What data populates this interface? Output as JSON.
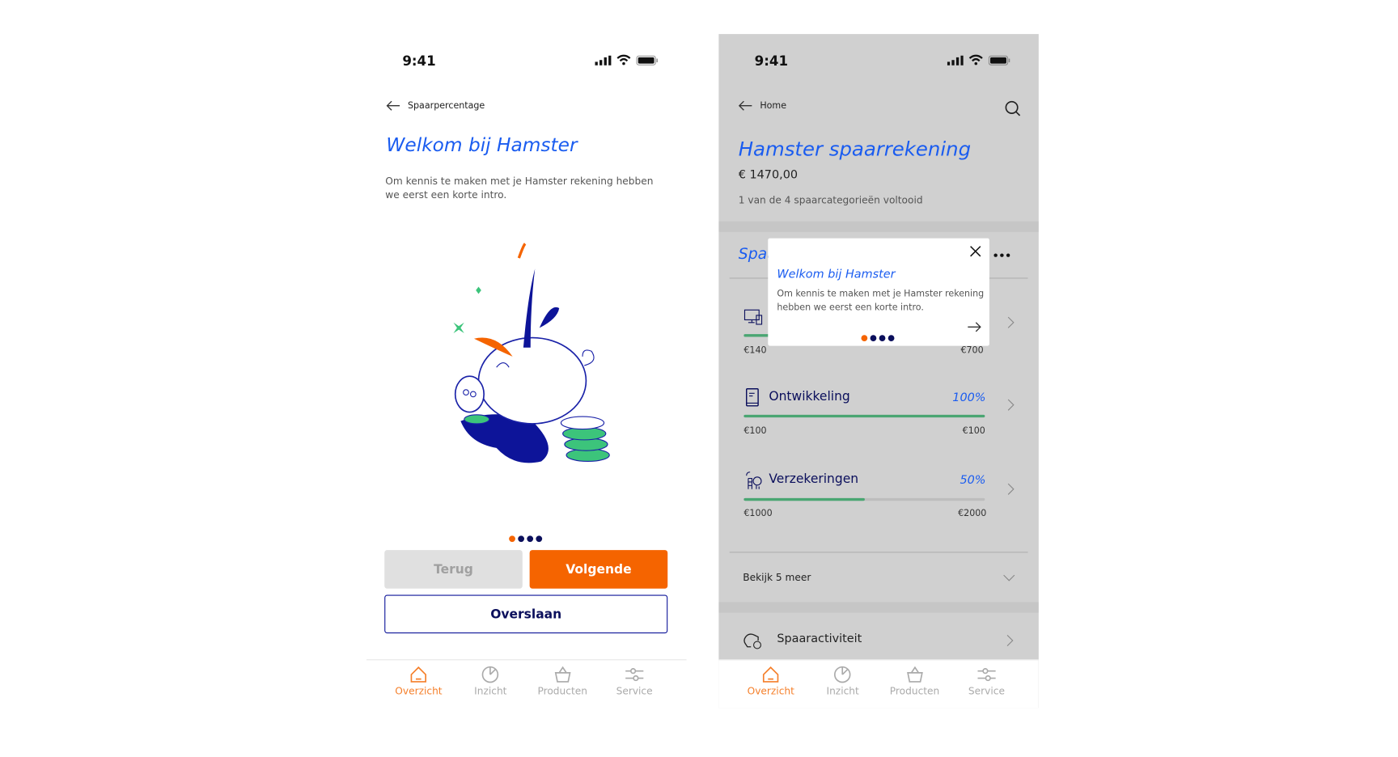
{
  "status_time": "9:41",
  "colors": {
    "accent": "#f56400",
    "title_blue": "#1a5cf0",
    "navy": "#0b0f5c",
    "progress_green": "#4aa672"
  },
  "onboarding": {
    "back_label": "Spaarpercentage",
    "title": "Welkom bij Hamster",
    "intro": "Om kennis te maken met je Hamster rekening hebben we eerst een korte intro.",
    "step": 1,
    "steps_total": 4,
    "back_button": "Terug",
    "next_button": "Volgende",
    "skip_button": "Overslaan"
  },
  "account": {
    "back_label": "Home",
    "title": "Hamster spaarrekening",
    "balance": "€ 1470,00",
    "progress_text": "1 van de 4 spaarcategorieën voltooid",
    "section_title": "Spaa",
    "categories": [
      {
        "name": "",
        "icon": "devices-icon",
        "percent": 20,
        "min": "€140",
        "max": "€700"
      },
      {
        "name": "Ontwikkeling",
        "icon": "book-icon",
        "percent": 100,
        "percent_label": "100%",
        "min": "€100",
        "max": "€100"
      },
      {
        "name": "Verzekeringen",
        "icon": "insurance-icon",
        "percent": 50,
        "percent_label": "50%",
        "min": "€1000",
        "max": "€2000"
      }
    ],
    "show_more": "Bekijk 5 meer",
    "activity": "Spaaractiviteit"
  },
  "popup": {
    "title": "Welkom bij Hamster",
    "body": "Om kennis te maken met je Hamster rekening hebben we eerst een korte intro."
  },
  "nav": [
    {
      "label": "Overzicht",
      "icon": "home-icon",
      "active": true
    },
    {
      "label": "Inzicht",
      "icon": "pie-chart-icon"
    },
    {
      "label": "Producten",
      "icon": "basket-icon"
    },
    {
      "label": "Service",
      "icon": "sliders-icon"
    }
  ]
}
